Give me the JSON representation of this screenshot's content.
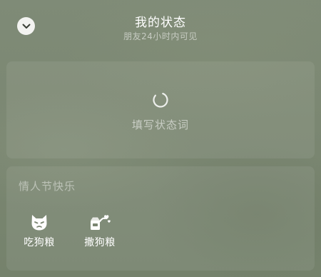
{
  "header": {
    "title": "我的状态",
    "subtitle": "朋友24小时内可见",
    "collapse_icon": "chevron-down-icon"
  },
  "status_card": {
    "loading_icon": "loading-spinner-icon",
    "prompt": "填写状态词"
  },
  "topic_card": {
    "title": "情人节快乐",
    "actions": [
      {
        "label": "吃狗粮",
        "icon": "grumpy-cat-icon"
      },
      {
        "label": "撒狗粮",
        "icon": "dog-food-hearts-icon"
      }
    ]
  }
}
